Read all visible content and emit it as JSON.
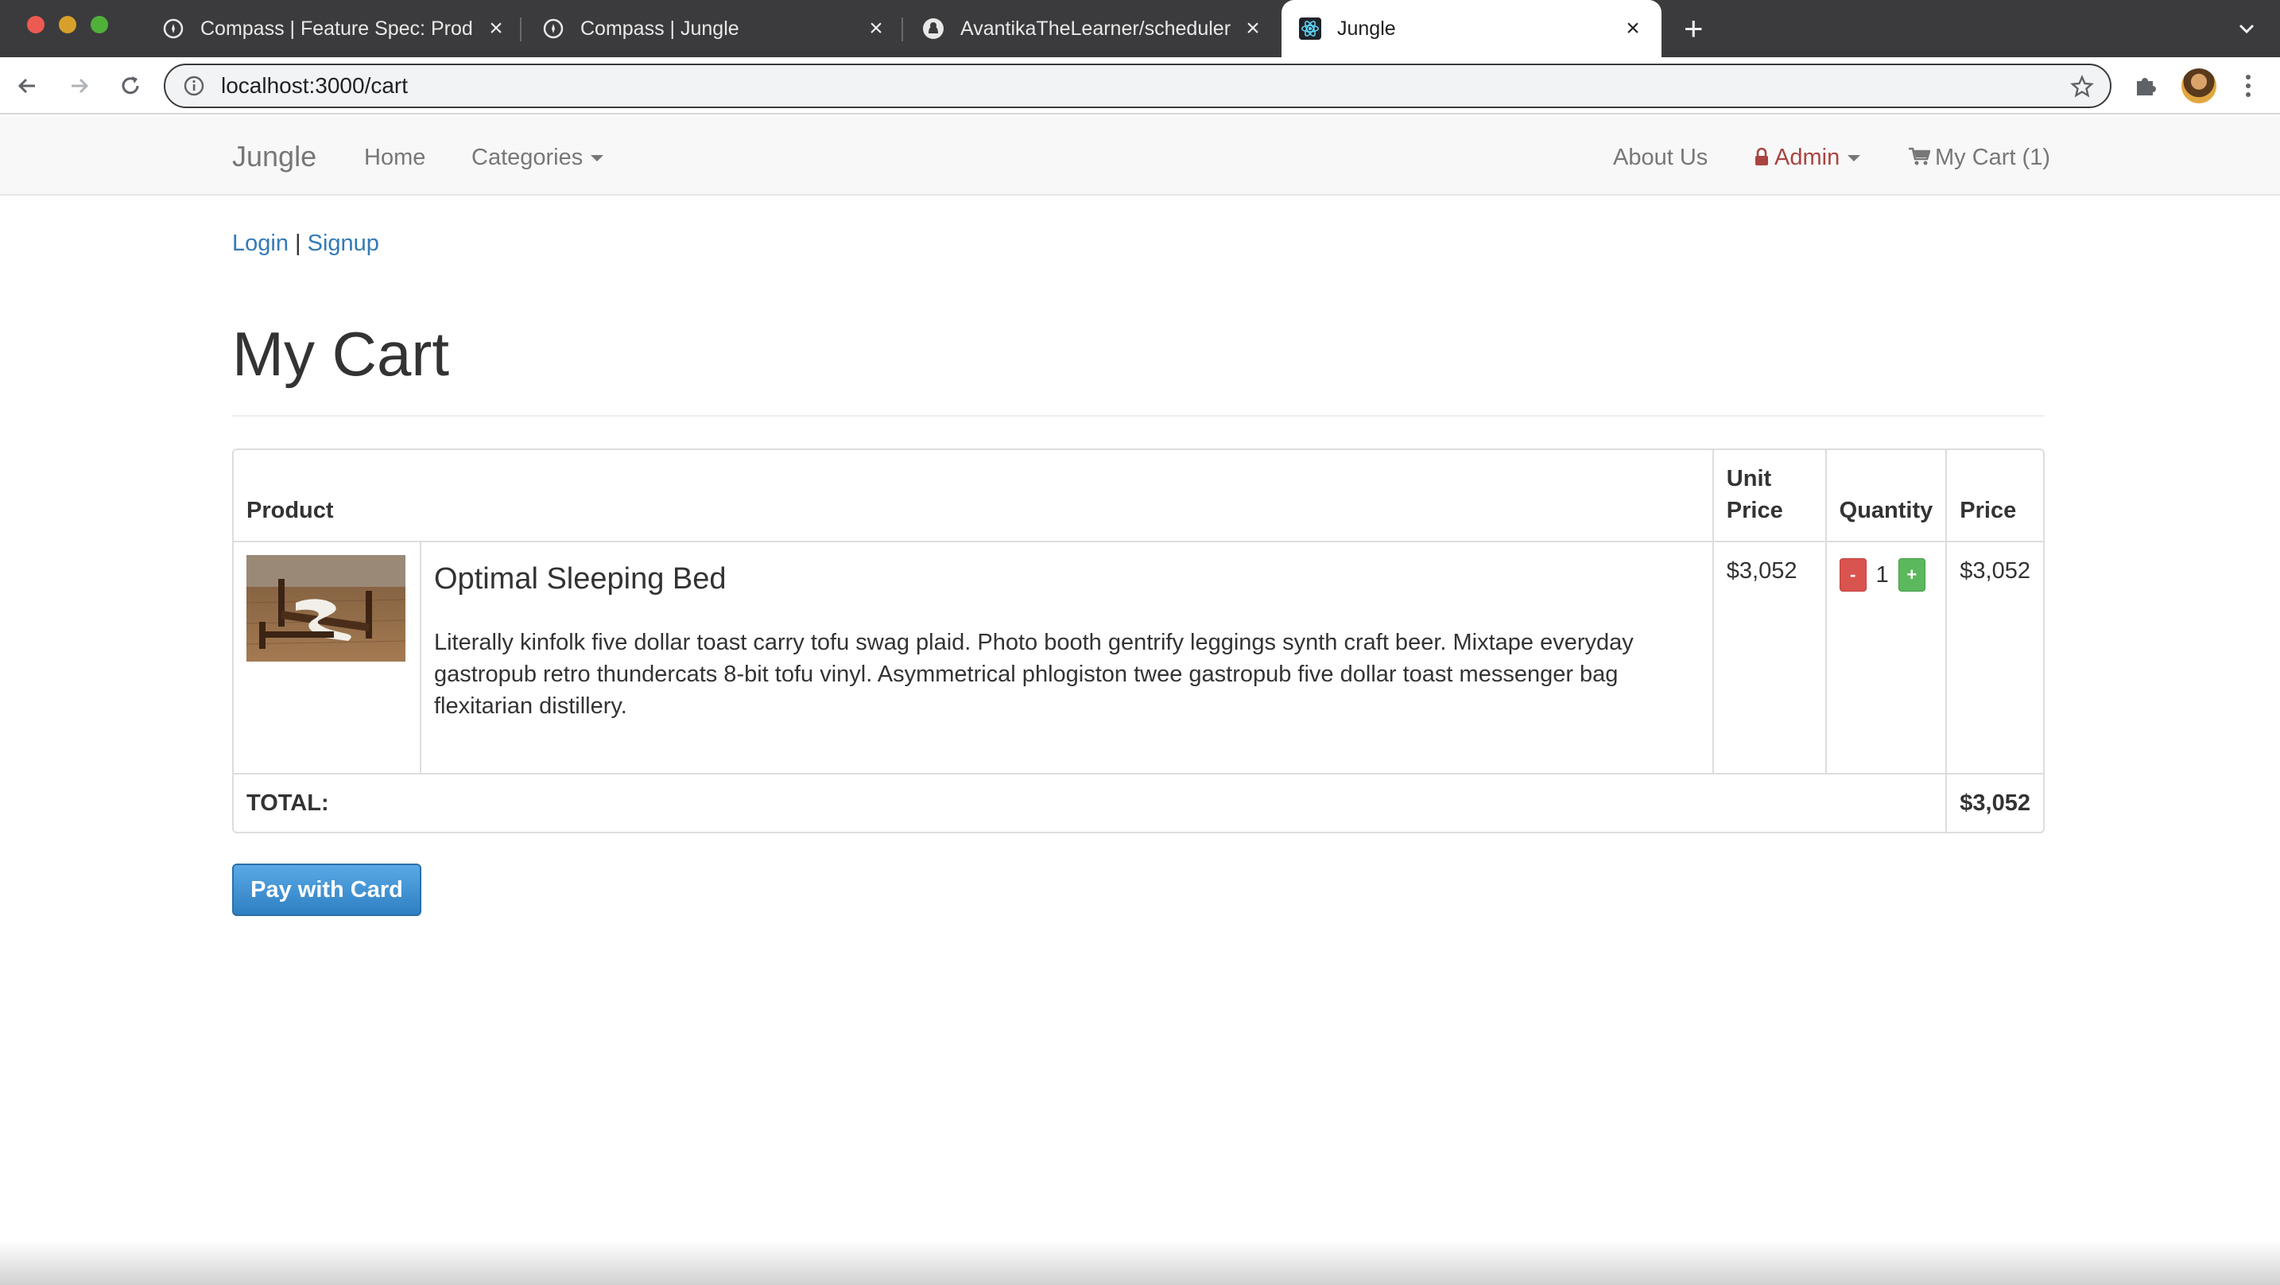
{
  "browser": {
    "tabs": [
      {
        "title": "Compass | Feature Spec: Produ",
        "favicon": "compass-icon",
        "active": false
      },
      {
        "title": "Compass | Jungle",
        "favicon": "compass-icon",
        "active": false
      },
      {
        "title": "AvantikaTheLearner/scheduler:",
        "favicon": "github-icon",
        "active": false
      },
      {
        "title": "Jungle",
        "favicon": "react-icon",
        "active": true
      }
    ],
    "url": "localhost:3000/cart"
  },
  "navbar": {
    "brand": "Jungle",
    "home": "Home",
    "categories": "Categories",
    "about": "About Us",
    "admin": "Admin",
    "cart": "My Cart (1)"
  },
  "auth": {
    "login": "Login",
    "separator": "|",
    "signup": "Signup"
  },
  "page": {
    "title": "My Cart"
  },
  "cart": {
    "headers": {
      "product": "Product",
      "unit_price_line1": "Unit",
      "unit_price_line2": "Price",
      "quantity": "Quantity",
      "price": "Price"
    },
    "items": [
      {
        "name": "Optimal Sleeping Bed",
        "description": "Literally kinfolk five dollar toast carry tofu swag plaid. Photo booth gentrify leggings synth craft beer. Mixtape everyday gastropub retro thundercats 8-bit tofu vinyl. Asymmetrical phlogiston twee gastropub five dollar toast messenger bag flexitarian distillery.",
        "unit_price": "$3,052",
        "quantity": "1",
        "minus": "-",
        "plus": "+",
        "price": "$3,052"
      }
    ],
    "total_label": "TOTAL:",
    "total": "$3,052"
  },
  "checkout": {
    "pay_label": "Pay with Card"
  },
  "colors": {
    "link": "#337ab7",
    "admin": "#a94442",
    "minus_button": "#d9534f",
    "plus_button": "#5cb85c",
    "pay_button": "#3a8ed4"
  }
}
